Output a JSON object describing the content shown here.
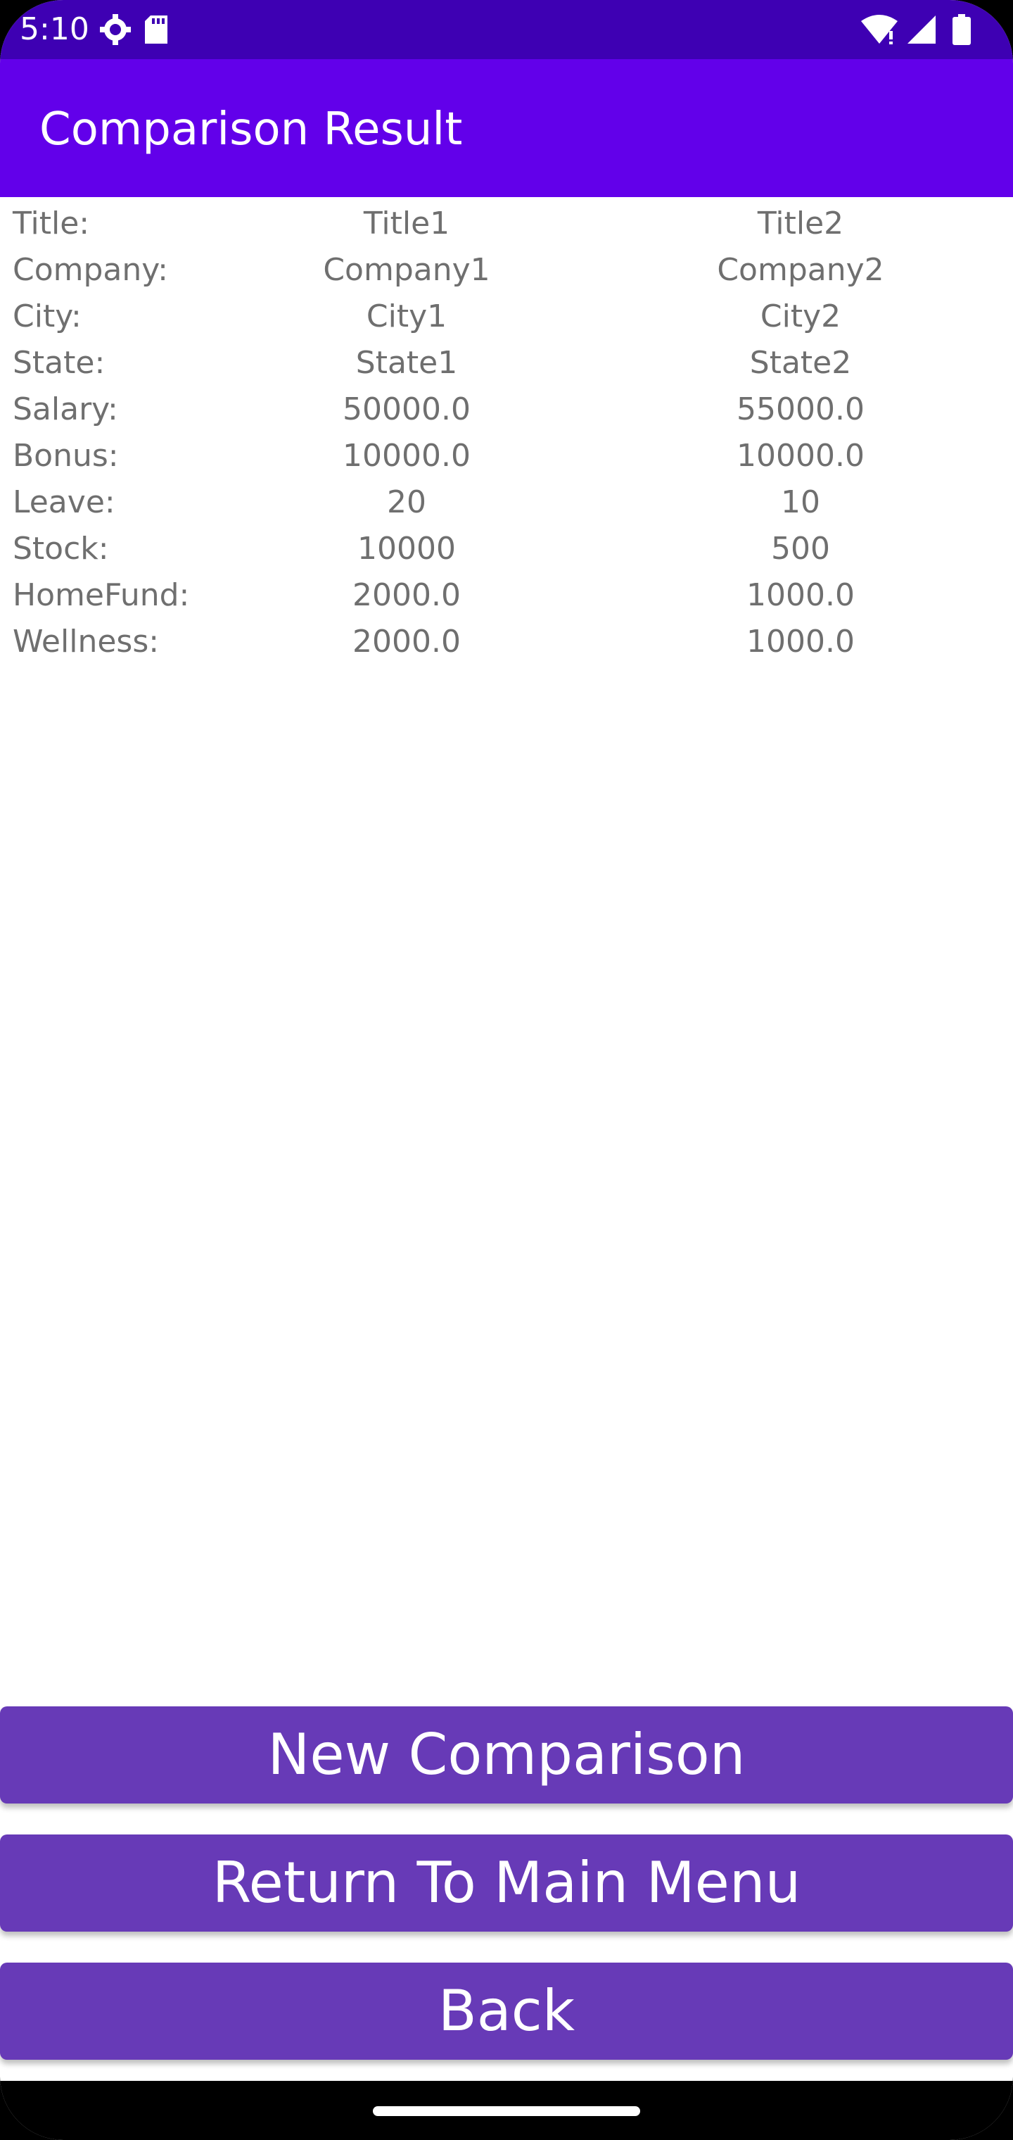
{
  "status_bar": {
    "time": "5:10",
    "left_icons": [
      "gear-icon",
      "sd-card-icon"
    ],
    "right_icons": [
      "wifi-icon",
      "signal-icon",
      "battery-icon"
    ]
  },
  "app_bar": {
    "title": "Comparison Result"
  },
  "comparison": {
    "rows": [
      {
        "label": "Title:",
        "v1": "Title1",
        "v2": "Title2"
      },
      {
        "label": "Company:",
        "v1": "Company1",
        "v2": "Company2"
      },
      {
        "label": "City:",
        "v1": "City1",
        "v2": "City2"
      },
      {
        "label": "State:",
        "v1": "State1",
        "v2": "State2"
      },
      {
        "label": "Salary:",
        "v1": "50000.0",
        "v2": "55000.0"
      },
      {
        "label": "Bonus:",
        "v1": "10000.0",
        "v2": "10000.0"
      },
      {
        "label": "Leave:",
        "v1": "20",
        "v2": "10"
      },
      {
        "label": "Stock:",
        "v1": "10000",
        "v2": "500"
      },
      {
        "label": "HomeFund:",
        "v1": "2000.0",
        "v2": "1000.0"
      },
      {
        "label": "Wellness:",
        "v1": "2000.0",
        "v2": "1000.0"
      }
    ]
  },
  "buttons": {
    "new_comparison": "New Comparison",
    "return_main_menu": "Return To Main Menu",
    "back": "Back"
  },
  "colors": {
    "status_bar": "#3e00b3",
    "app_bar": "#6200ea",
    "button": "#673ab7",
    "text": "#6f6f6f"
  }
}
